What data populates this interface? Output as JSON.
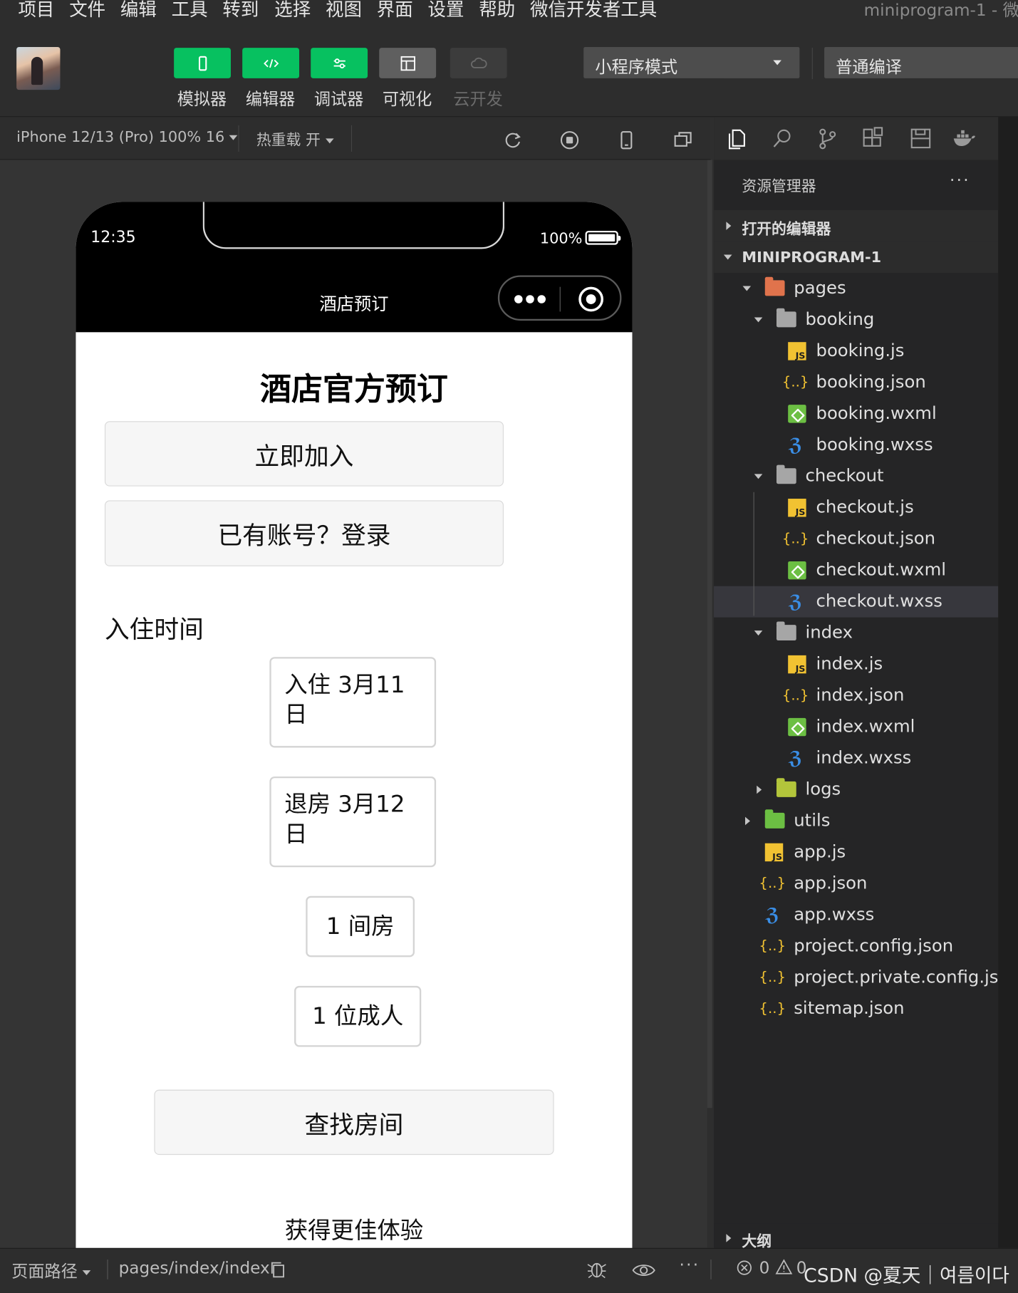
{
  "menu": {
    "items": [
      "项目",
      "文件",
      "编辑",
      "工具",
      "转到",
      "选择",
      "视图",
      "界面",
      "设置",
      "帮助",
      "微信开发者工具"
    ],
    "window_title": "miniprogram-1 - 微"
  },
  "toolbar": {
    "buttons": [
      {
        "label": "模拟器",
        "icon": "phone-icon"
      },
      {
        "label": "编辑器",
        "icon": "code-icon"
      },
      {
        "label": "调试器",
        "icon": "sliders-icon"
      },
      {
        "label": "可视化",
        "icon": "layout-icon"
      },
      {
        "label": "云开发",
        "icon": "cloud-icon"
      }
    ],
    "mode_select": "小程序模式",
    "compile_select": "普通编译"
  },
  "simulator_bar": {
    "device": "iPhone 12/13 (Pro) 100% 16",
    "hot_reload": "热重载 开"
  },
  "phone": {
    "status_time": "12:35",
    "battery_text": "100%",
    "nav_title": "酒店预订",
    "page_title": "酒店官方预订",
    "join_button": "立即加入",
    "login_button": "已有账号？登录",
    "checkin_section_label": "入住时间",
    "checkin_line1": "入住 3月11",
    "checkin_line2": "日",
    "checkout_line1": "退房 3月12",
    "checkout_line2": "日",
    "rooms": "1 间房",
    "adults": "1 位成人",
    "search_button": "查找房间",
    "bottom_text": "获得更佳体验"
  },
  "explorer": {
    "title": "资源管理器",
    "more": "···",
    "open_editors": "打开的编辑器",
    "project": "MINIPROGRAM-1",
    "tree": {
      "pages": "pages",
      "booking": "booking",
      "booking_js": "booking.js",
      "booking_json": "booking.json",
      "booking_wxml": "booking.wxml",
      "booking_wxss": "booking.wxss",
      "checkout": "checkout",
      "checkout_js": "checkout.js",
      "checkout_json": "checkout.json",
      "checkout_wxml": "checkout.wxml",
      "checkout_wxss": "checkout.wxss",
      "index": "index",
      "index_js": "index.js",
      "index_json": "index.json",
      "index_wxml": "index.wxml",
      "index_wxss": "index.wxss",
      "logs": "logs",
      "utils": "utils",
      "app_js": "app.js",
      "app_json": "app.json",
      "app_wxss": "app.wxss",
      "project_config": "project.config.json",
      "project_private": "project.private.config.js...",
      "sitemap": "sitemap.json"
    },
    "outline": "大纲"
  },
  "statusbar": {
    "page_path_label": "页面路径",
    "page_path": "pages/index/index",
    "errors": "0",
    "warnings": "0",
    "watermark": "CSDN @夏天｜여름이다"
  },
  "colors": {
    "accent_green": "#07c160",
    "js_yellow": "#f1c232",
    "wxss_blue": "#3a8ee6",
    "wxml_green": "#6cbf43"
  }
}
